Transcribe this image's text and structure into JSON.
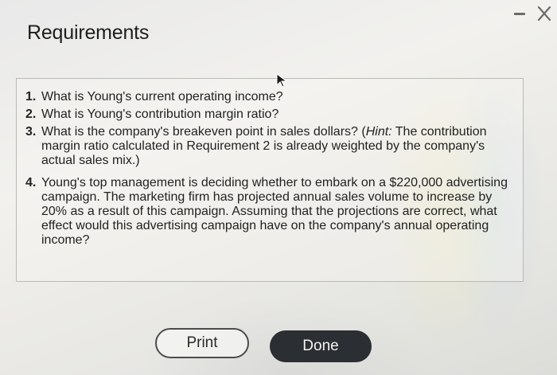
{
  "page": {
    "title": "Requirements"
  },
  "window_controls": {
    "minimize_icon": "minimize-icon",
    "close_icon": "close-icon"
  },
  "requirements": [
    {
      "number": "1.",
      "text": "What is Young's current operating income?"
    },
    {
      "number": "2.",
      "text": "What is Young's contribution margin ratio?"
    },
    {
      "number": "3.",
      "text_before_hint": "What is the company's breakeven point in sales dollars? (",
      "hint_label": "Hint:",
      "text_after_hint": " The contribution margin ratio calculated in Requirement 2 is already weighted by the company's actual sales mix.)"
    },
    {
      "number": "4.",
      "text": "Young's top management is deciding whether to embark on a $220,000 advertising campaign. The marketing firm has projected annual sales volume to increase by 20% as a result of this campaign. Assuming that the projections are correct, what effect would this advertising campaign have on the company's annual operating income?"
    }
  ],
  "actions": {
    "print_label": "Print",
    "done_label": "Done"
  },
  "colors": {
    "done_background": "#2b2e32",
    "print_border": "#4c4c4c",
    "box_border": "#b9b9b6"
  }
}
